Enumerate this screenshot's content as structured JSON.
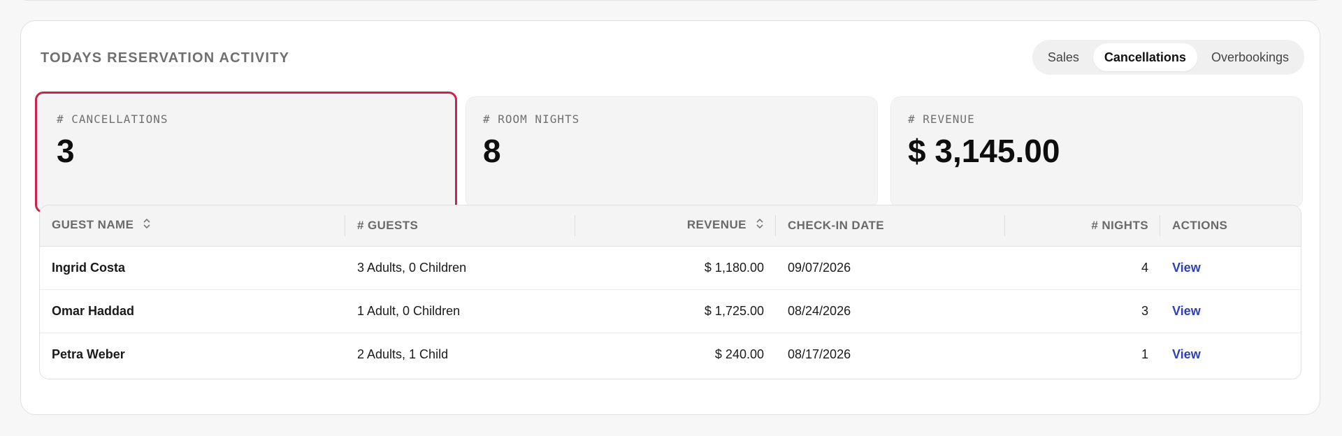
{
  "panel": {
    "title": "TODAYS RESERVATION ACTIVITY",
    "tabs": [
      {
        "label": "Sales",
        "active": false
      },
      {
        "label": "Cancellations",
        "active": true
      },
      {
        "label": "Overbookings",
        "active": false
      }
    ]
  },
  "stats": [
    {
      "label": "# CANCELLATIONS",
      "value": "3",
      "selected": true
    },
    {
      "label": "# ROOM NIGHTS",
      "value": "8",
      "selected": false
    },
    {
      "label": "# REVENUE",
      "value": "$ 3,145.00",
      "selected": false
    }
  ],
  "table": {
    "headers": {
      "guest_name": "GUEST NAME",
      "guests": "# GUESTS",
      "revenue": "REVENUE",
      "checkin": "CHECK-IN DATE",
      "nights": "# NIGHTS",
      "actions": "ACTIONS"
    },
    "rows": [
      {
        "guest_name": "Ingrid Costa",
        "guests": "3 Adults, 0 Children",
        "revenue": "$ 1,180.00",
        "checkin": "09/07/2026",
        "nights": "4",
        "action": "View"
      },
      {
        "guest_name": "Omar Haddad",
        "guests": "1 Adult, 0 Children",
        "revenue": "$ 1,725.00",
        "checkin": "08/24/2026",
        "nights": "3",
        "action": "View"
      },
      {
        "guest_name": "Petra Weber",
        "guests": "2 Adults, 1 Child",
        "revenue": "$ 240.00",
        "checkin": "08/17/2026",
        "nights": "1",
        "action": "View"
      }
    ]
  },
  "colors": {
    "accent_selected": "#c8244d",
    "link": "#2f3fb5"
  }
}
